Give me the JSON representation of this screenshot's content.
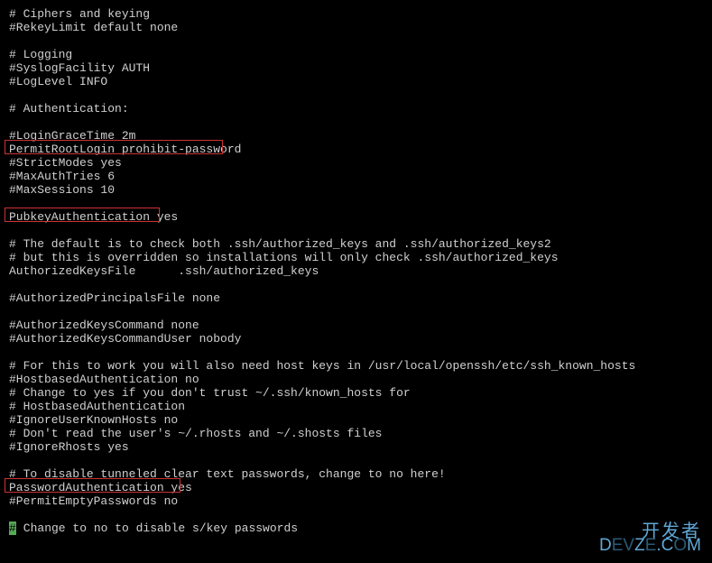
{
  "lines": [
    "# Ciphers and keying",
    "#RekeyLimit default none",
    "",
    "# Logging",
    "#SyslogFacility AUTH",
    "#LogLevel INFO",
    "",
    "# Authentication:",
    "",
    "#LoginGraceTime 2m",
    "PermitRootLogin prohibit-password",
    "#StrictModes yes",
    "#MaxAuthTries 6",
    "#MaxSessions 10",
    "",
    "PubkeyAuthentication yes",
    "",
    "# The default is to check both .ssh/authorized_keys and .ssh/authorized_keys2",
    "# but this is overridden so installations will only check .ssh/authorized_keys",
    "AuthorizedKeysFile      .ssh/authorized_keys",
    "",
    "#AuthorizedPrincipalsFile none",
    "",
    "#AuthorizedKeysCommand none",
    "#AuthorizedKeysCommandUser nobody",
    "",
    "# For this to work you will also need host keys in /usr/local/openssh/etc/ssh_known_hosts",
    "#HostbasedAuthentication no",
    "# Change to yes if you don't trust ~/.ssh/known_hosts for",
    "# HostbasedAuthentication",
    "#IgnoreUserKnownHosts no",
    "# Don't read the user's ~/.rhosts and ~/.shosts files",
    "#IgnoreRhosts yes",
    "",
    "# To disable tunneled clear text passwords, change to no here!",
    "PasswordAuthentication yes",
    "#PermitEmptyPasswords no",
    "",
    "# Change to no to disable s/key passwords"
  ],
  "cursor_line_index": 38,
  "cursor_char": "#",
  "highlights": {
    "box1_label": "PermitRootLogin highlight",
    "box2_label": "PubkeyAuthentication highlight",
    "box3_label": "PasswordAuthentication highlight"
  },
  "watermark": {
    "top": "开发者",
    "bottom_prefix": "D",
    "bottom_mid": "EV",
    "bottom_z": "Z",
    "bottom_e": "E",
    "bottom_dot": ".",
    "bottom_c": "C",
    "bottom_o": "O",
    "bottom_m": "M"
  },
  "colors": {
    "bg": "#000000",
    "fg": "#d0d0d0",
    "highlight_border": "#cc3333",
    "cursor_bg": "#55aa55",
    "watermark": "#5fa8d6"
  }
}
